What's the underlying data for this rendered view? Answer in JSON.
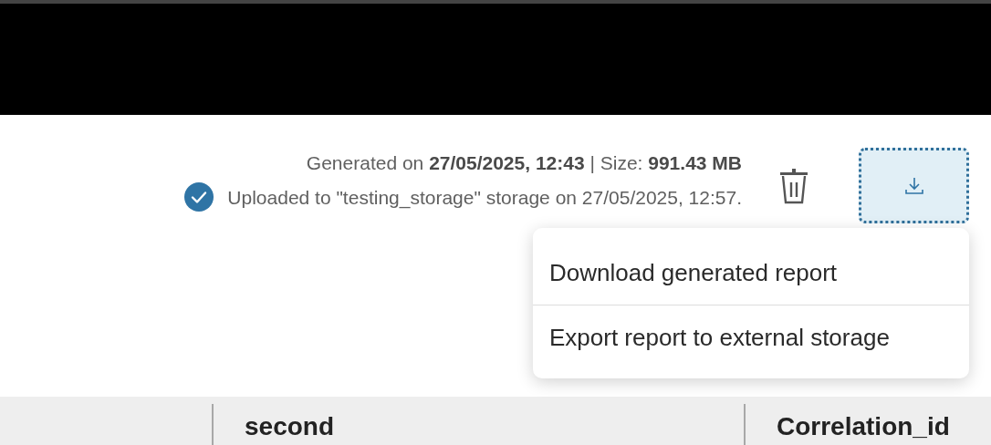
{
  "report": {
    "generated": "Generated on **27/05/2025, 12:43** | Size: **991.43 MB**",
    "upload_status": {
      "uploaded": true,
      "text": "Uploaded to \"testing_storage\" storage on 27/05/2025, 12:57."
    }
  },
  "download_button": {
    "focused": true,
    "menu_open": true
  },
  "menu": {
    "items": [
      {
        "label": "Download generated report"
      },
      {
        "label": "Export report to external storage"
      }
    ]
  },
  "table": {
    "columns": [
      "second",
      "Correlation_id"
    ]
  }
}
